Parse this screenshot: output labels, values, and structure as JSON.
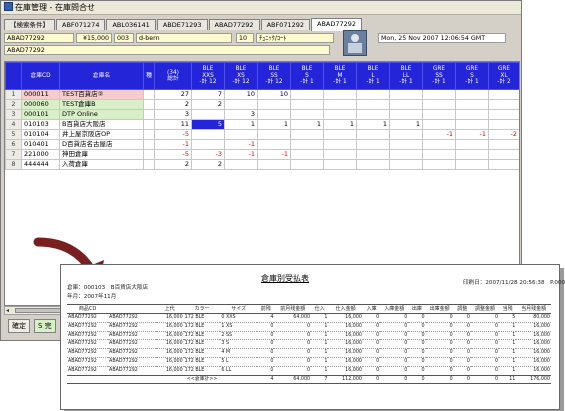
{
  "window": {
    "title": "在庫管理 - 在庫問合せ"
  },
  "tabs": [
    "【検索条件】",
    "ABF071274",
    "ABL036141",
    "ABDE71293",
    "ABAD77292",
    "ABF071292",
    "ABAD77292"
  ],
  "active_tab": 6,
  "fields": {
    "product_code": "ABAD77292",
    "price": "¥15,000",
    "color_code": "003",
    "color_name": "d-bern",
    "category_code": "10",
    "category_name": "ﾁｭﾆｯｸ/ｺｰﾄ",
    "product_name": "ABAD77292",
    "timestamp": "Mon, 25 Nov 2007 12:06:54 GMT"
  },
  "grid": {
    "headers": [
      "倉庫CD",
      "倉庫名",
      "種",
      "(34)\n総計",
      "BLE\nXXS\n-計 12",
      "BLE\nXS\n-計 12",
      "BLE\nSS\n-計 12",
      "BLE\nS\n-計 1",
      "BLE\nM\n-計 1",
      "BLE\nL\n-計 1",
      "BLE\nLL\n-計 1",
      "GRE\nSS\n-計 1",
      "GRE\nS\n-計 1",
      "GRE\nXL\n-計 2"
    ],
    "rows": [
      {
        "n": "1",
        "code": "000011",
        "name": "TEST百貨店②",
        "vals": [
          "",
          "27",
          "7",
          "10",
          "10",
          "",
          "",
          "",
          "",
          "",
          "",
          ""
        ]
      },
      {
        "n": "2",
        "code": "000060",
        "name": "TEST倉庫B",
        "vals": [
          "",
          "2",
          "2",
          "",
          "",
          "",
          "",
          "",
          "",
          "",
          "",
          ""
        ]
      },
      {
        "n": "3",
        "code": "000101",
        "name": "DTP Online",
        "vals": [
          "",
          "3",
          "",
          "3",
          "",
          "",
          "",
          "",
          "",
          "",
          "",
          ""
        ]
      },
      {
        "n": "4",
        "code": "010103",
        "name": "B百貨店大阪店",
        "vals": [
          "",
          "11",
          "5",
          "1",
          "1",
          "1",
          "1",
          "1",
          "1",
          "",
          "",
          ""
        ]
      },
      {
        "n": "5",
        "code": "010104",
        "name": "井上屋京阪店OP",
        "vals": [
          "",
          "-5",
          "",
          "",
          "",
          "",
          "",
          "",
          "",
          "-1",
          "-1",
          "-2"
        ]
      },
      {
        "n": "6",
        "code": "010401",
        "name": "D百貨店名古屋店",
        "vals": [
          "",
          "-1",
          "",
          "-1",
          "",
          "",
          "",
          "",
          "",
          "",
          "",
          ""
        ]
      },
      {
        "n": "7",
        "code": "221000",
        "name": "神田倉庫",
        "vals": [
          "",
          "-5",
          "-3",
          "-1",
          "-1",
          "",
          "",
          "",
          "",
          "",
          "",
          ""
        ]
      },
      {
        "n": "8",
        "code": "444444",
        "name": "入荷倉庫",
        "vals": [
          "",
          "2",
          "2",
          "",
          "",
          "",
          "",
          "",
          "",
          "",
          "",
          ""
        ]
      }
    ]
  },
  "status": {
    "label1": "確定",
    "label2": "S 完"
  },
  "report": {
    "title": "倉庫別受払表",
    "warehouse": "倉庫：000103　B百貨店大阪店",
    "period": "年月：2007年11月",
    "printed": "印刷日：2007/11/28 20:56:38　P.0001",
    "headers": [
      "商品CD",
      "",
      "上代",
      "カラー",
      "サイズ",
      "前残",
      "前月残金額",
      "仕入",
      "仕入金額",
      "入庫",
      "入庫金額",
      "出庫",
      "出庫金額",
      "調整",
      "調整金額",
      "当残",
      "当月残金額"
    ],
    "rows": [
      [
        "ABAD77292",
        "ABAD77292",
        "16,000",
        "172 BLE",
        "0 XXS",
        "4",
        "64,000",
        "1",
        "16,000",
        "0",
        "0",
        "0",
        "0",
        "0",
        "0",
        "5",
        "80,000"
      ],
      [
        "ABAD77292",
        "ABAD77292",
        "16,000",
        "172 BLE",
        "1 XS",
        "0",
        "0",
        "1",
        "16,000",
        "0",
        "0",
        "0",
        "0",
        "0",
        "0",
        "1",
        "16,000"
      ],
      [
        "ABAD77292",
        "ABAD77292",
        "16,000",
        "172 BLE",
        "2 SS",
        "0",
        "0",
        "1",
        "16,000",
        "0",
        "0",
        "0",
        "0",
        "0",
        "0",
        "1",
        "16,000"
      ],
      [
        "ABAD77292",
        "ABAD77292",
        "16,000",
        "172 BLE",
        "3 S",
        "0",
        "0",
        "1",
        "16,000",
        "0",
        "0",
        "0",
        "0",
        "0",
        "0",
        "1",
        "16,000"
      ],
      [
        "ABAD77292",
        "ABAD77292",
        "16,000",
        "172 BLE",
        "4 M",
        "0",
        "0",
        "1",
        "16,000",
        "0",
        "0",
        "0",
        "0",
        "0",
        "0",
        "1",
        "16,000"
      ],
      [
        "ABAD77292",
        "ABAD77292",
        "16,000",
        "172 BLE",
        "5 L",
        "0",
        "0",
        "1",
        "16,000",
        "0",
        "0",
        "0",
        "0",
        "0",
        "0",
        "1",
        "16,000"
      ],
      [
        "ABAD77292",
        "ABAD77292",
        "16,000",
        "172 BLE",
        "6 LL",
        "0",
        "0",
        "1",
        "16,000",
        "0",
        "0",
        "0",
        "0",
        "0",
        "0",
        "1",
        "16,000"
      ]
    ],
    "total_label": "<<倉庫計>>",
    "totals": [
      "4",
      "64,000",
      "7",
      "112,000",
      "0",
      "0",
      "0",
      "0",
      "0",
      "0",
      "11",
      "176,000"
    ]
  },
  "colors": {
    "header_blue": "#2424d8",
    "row_highlight_pink": "#f6cccc",
    "row_highlight_green": "#d8f0c8",
    "field_yellow": "#fffbd0",
    "negative_red": "#e00000"
  }
}
